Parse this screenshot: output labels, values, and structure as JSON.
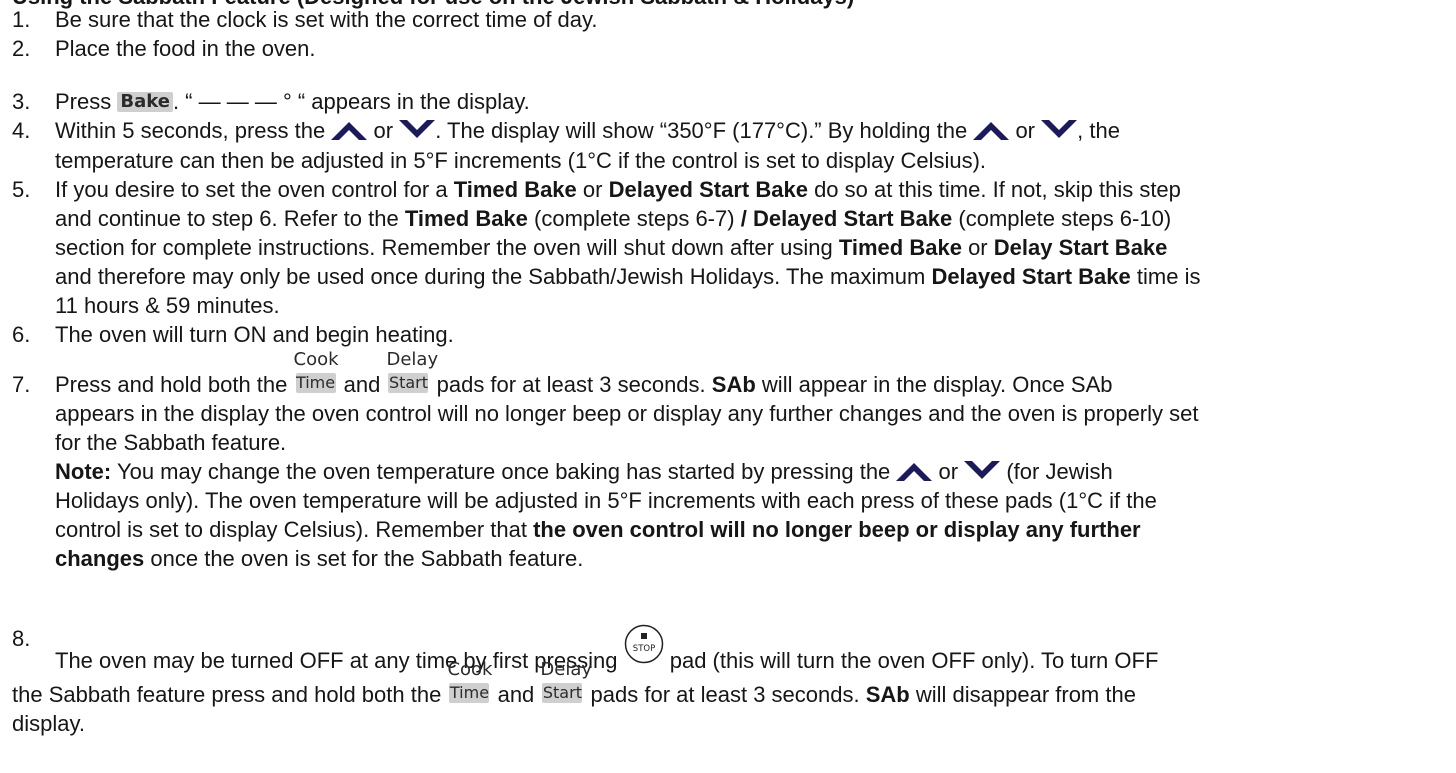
{
  "heading": "Using the Sabbath Feature (Designed for use on the Jewish Sabbath & Holidays)",
  "pads": {
    "bake": "Bake",
    "cook": "Cook",
    "time": "Time",
    "delay": "Delay",
    "start": "Start",
    "stop": "STOP"
  },
  "icons": [
    "up-arrow-icon",
    "down-arrow-icon",
    "stop-pad-icon"
  ],
  "steps": {
    "s1": {
      "num": "1.",
      "text": "Be sure that the clock is set with the correct time of day."
    },
    "s2": {
      "num": "2.",
      "text": "Place the food in the oven."
    },
    "s3": {
      "num": "3.",
      "a": "Press",
      "b": ". “ — — — ° “ appears in the display."
    },
    "s4": {
      "num": "4.",
      "a": "Within 5 seconds, press the",
      "or": "or",
      "b": ". The display will show “350°F (177°C).” By holding the",
      "c": ", the",
      "line2": "temperature can then be adjusted in 5°F increments (1°C if the control is set to display Celsius)."
    },
    "s5": {
      "num": "5.",
      "l1a": "If you desire to set the oven control for a",
      "tb": "Timed Bake",
      "or_word": "or",
      "dsb": "Delayed Start Bake",
      "l1b": "do so at this time. If not, skip this step",
      "l2": "and continue to step 6. Refer to the",
      "l2b": "(complete steps 6-7)",
      "slash": "/",
      "l2c": "(complete steps 6-10)",
      "l3a": "section for complete instructions. Remember the oven will shut down after using",
      "l3or": "or",
      "dlsb": "Delay Start Bake",
      "l4a": "and therefore may only be used once during the Sabbath/Jewish Holidays. The maximum",
      "l4b": "time is",
      "l5": "11 hours & 59 minutes."
    },
    "s6": {
      "num": "6.",
      "text": "The oven will turn ON and begin heating."
    },
    "s7": {
      "num": "7.",
      "a": "Press and hold both the",
      "and": "and",
      "b": "pads for at least 3 seconds.",
      "sab": "SAb",
      "c": "will appear in the display. Once SAb",
      "l2": "appears in the display the oven control will no longer beep or display any further changes and the oven is properly set",
      "l3": "for the Sabbath feature.",
      "note_label": "Note:",
      "note_a": "You may change the oven temperature once baking has started by pressing the",
      "note_or": "or",
      "note_b": "(for Jewish",
      "l5": "Holidays only). The oven temperature will be adjusted in 5°F increments with each press of these pads (1°C if the",
      "l6a": "control is set to display Celsius). Remember that",
      "l6b": "the oven control will no longer beep or display any further",
      "l7a": "changes",
      "l7b": "once the oven is set for the Sabbath feature."
    },
    "s8": {
      "num": "8.",
      "a": "The oven may be turned OFF at any time by first pressing",
      "b": "pad (this will turn the oven OFF only). To turn OFF",
      "l2a": "the Sabbath feature press and hold both the",
      "and": "and",
      "l2b": "pads for at least 3 seconds.",
      "sab": "SAb",
      "l2c": "will disappear from the",
      "l3": "display."
    }
  }
}
